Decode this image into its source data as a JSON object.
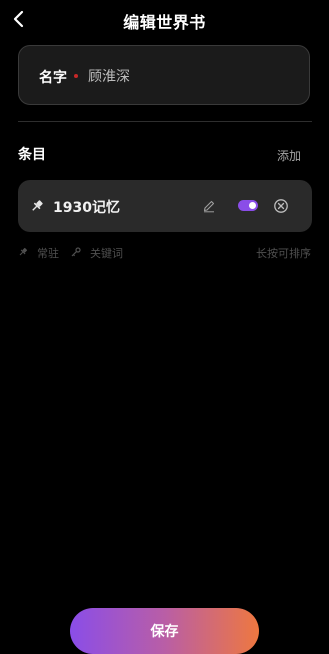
{
  "header": {
    "title": "编辑世界书",
    "back_icon": "chevron-left-icon"
  },
  "name_field": {
    "label": "名字",
    "value": "顾淮深",
    "required": true,
    "required_color": "#c62828"
  },
  "entries_section": {
    "title": "条目",
    "add_label": "添加",
    "items": [
      {
        "name": "1930记忆",
        "pinned": true,
        "enabled": true
      }
    ]
  },
  "legend": {
    "resident_label": "常驻",
    "keyword_label": "关键词",
    "sort_hint": "长按可排序"
  },
  "footer": {
    "save_label": "保存"
  },
  "colors": {
    "background": "#000000",
    "card": "#2a2a2a",
    "accent_purple": "#8a4de8",
    "accent_orange": "#ee7840"
  }
}
